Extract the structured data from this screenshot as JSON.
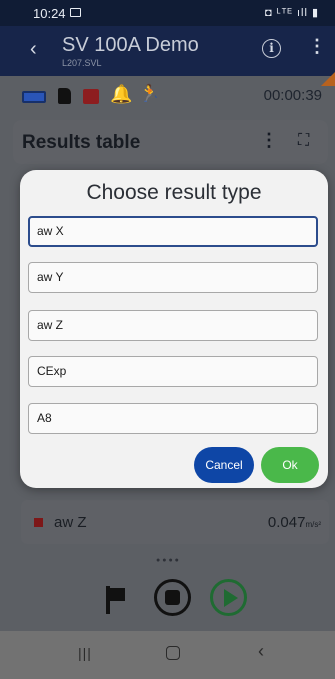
{
  "status_bar": {
    "time": "10:24",
    "right_icons": "◘ ᴸᵀᴱ ıll ▮"
  },
  "app_bar": {
    "title": "SV 100A Demo",
    "subtitle": "L207.SVL",
    "back_icon": "‹",
    "info_icon": "i",
    "more_icon": "⋮"
  },
  "indicators": {
    "bell_glyph": "🔔",
    "person_glyph": "🏃",
    "elapsed_time": "00:00:39"
  },
  "results_card": {
    "title": "Results table",
    "menu_icon": "⋮",
    "expand_icon": "⛶"
  },
  "dialog": {
    "title": "Choose result type",
    "options": [
      "aw X",
      "aw Y",
      "aw Z",
      "CExp",
      "A8"
    ],
    "selected_index": 0,
    "cancel_label": "Cancel",
    "ok_label": "Ok"
  },
  "result_row": {
    "label": "aw Z",
    "value": "0.047",
    "unit": "m/s²"
  },
  "page_dots": "●●●●",
  "nav": {
    "recents_icon": "|||",
    "back_icon": "‹"
  },
  "colors": {
    "cancel_button": "#0e46a6",
    "ok_button": "#4ab84a",
    "app_bar": "#17254a",
    "accent": "#b8621e"
  }
}
